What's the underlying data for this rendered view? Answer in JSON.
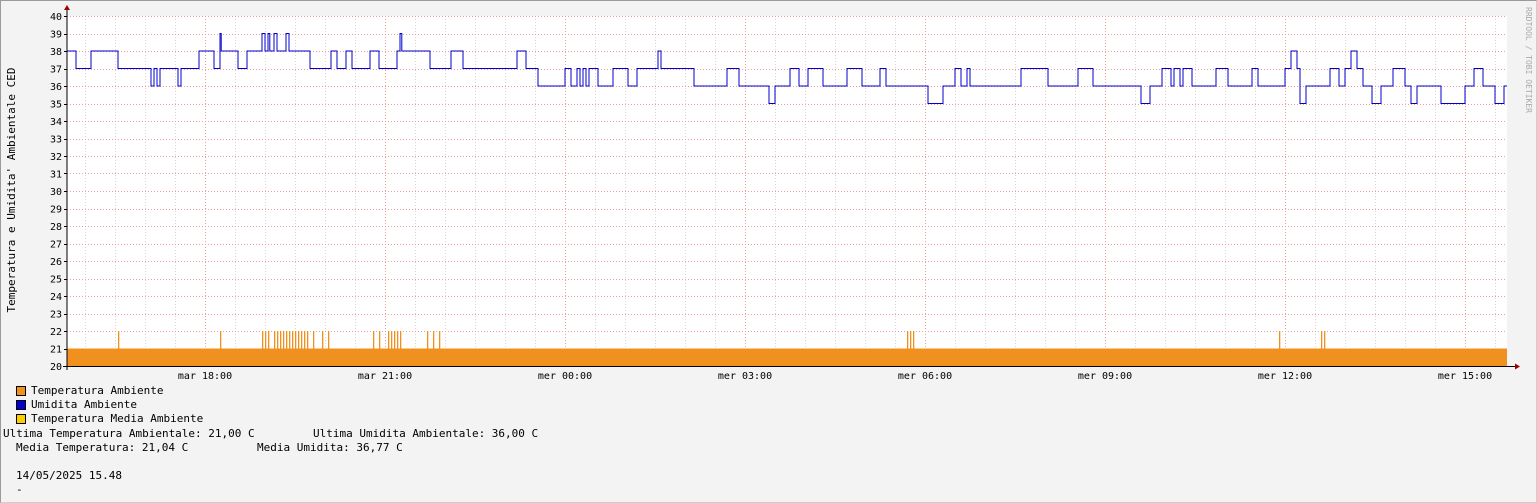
{
  "chart_data": {
    "type": "area",
    "ylabel": "Temperatura e Umidita' Ambientale CED",
    "watermark": "RRDTOOL / TOBI OETIKER",
    "ylim": [
      20,
      40
    ],
    "yticks": [
      "20",
      "21",
      "22",
      "23",
      "24",
      "25",
      "26",
      "27",
      "28",
      "29",
      "30",
      "31",
      "32",
      "33",
      "34",
      "35",
      "36",
      "37",
      "38",
      "39",
      "40"
    ],
    "xlim_hours": [
      0,
      24
    ],
    "xticks": [
      {
        "label": "mar 18:00",
        "hour": 2.3
      },
      {
        "label": "mar 21:00",
        "hour": 5.3
      },
      {
        "label": "mer 00:00",
        "hour": 8.3
      },
      {
        "label": "mer 03:00",
        "hour": 11.3
      },
      {
        "label": "mer 06:00",
        "hour": 14.3
      },
      {
        "label": "mer 09:00",
        "hour": 17.3
      },
      {
        "label": "mer 12:00",
        "hour": 20.3
      },
      {
        "label": "mer 15:00",
        "hour": 23.3
      }
    ],
    "series": [
      {
        "name": "Temperatura Ambiente",
        "color": "#f0901e",
        "baseline": 21,
        "spikes_to_22": [
          0.85,
          2.55,
          3.25,
          3.3,
          3.35,
          3.45,
          3.5,
          3.55,
          3.6,
          3.65,
          3.7,
          3.75,
          3.8,
          3.85,
          3.9,
          3.95,
          4.0,
          4.1,
          4.25,
          4.35,
          5.1,
          5.2,
          5.35,
          5.4,
          5.45,
          5.5,
          5.55,
          6.0,
          6.1,
          6.2,
          14.0,
          14.05,
          14.1,
          20.2,
          20.9,
          20.95
        ]
      },
      {
        "name": "Umidita Ambiente",
        "color": "#0000cc",
        "points": [
          [
            0.0,
            38
          ],
          [
            0.15,
            37
          ],
          [
            0.4,
            38
          ],
          [
            0.85,
            37
          ],
          [
            1.4,
            36
          ],
          [
            1.45,
            37
          ],
          [
            1.5,
            36
          ],
          [
            1.55,
            37
          ],
          [
            1.85,
            36
          ],
          [
            1.9,
            37
          ],
          [
            2.2,
            38
          ],
          [
            2.45,
            37
          ],
          [
            2.55,
            39
          ],
          [
            2.57,
            38
          ],
          [
            2.85,
            37
          ],
          [
            3.0,
            38
          ],
          [
            3.2,
            38
          ],
          [
            3.25,
            39
          ],
          [
            3.3,
            38
          ],
          [
            3.35,
            39
          ],
          [
            3.38,
            38
          ],
          [
            3.45,
            39
          ],
          [
            3.5,
            38
          ],
          [
            3.65,
            39
          ],
          [
            3.7,
            38
          ],
          [
            3.75,
            38
          ],
          [
            3.95,
            38
          ],
          [
            4.05,
            37
          ],
          [
            4.4,
            38
          ],
          [
            4.5,
            37
          ],
          [
            4.65,
            38
          ],
          [
            4.75,
            37
          ],
          [
            5.05,
            38
          ],
          [
            5.2,
            37
          ],
          [
            5.3,
            37
          ],
          [
            5.5,
            38
          ],
          [
            5.55,
            39
          ],
          [
            5.58,
            38
          ],
          [
            5.65,
            38
          ],
          [
            5.95,
            38
          ],
          [
            6.05,
            37
          ],
          [
            6.4,
            38
          ],
          [
            6.6,
            37
          ],
          [
            6.65,
            37
          ],
          [
            6.75,
            37
          ],
          [
            7.4,
            37
          ],
          [
            7.5,
            38
          ],
          [
            7.65,
            37
          ],
          [
            7.85,
            36
          ],
          [
            8.2,
            36
          ],
          [
            8.3,
            37
          ],
          [
            8.4,
            36
          ],
          [
            8.5,
            37
          ],
          [
            8.55,
            36
          ],
          [
            8.6,
            37
          ],
          [
            8.65,
            36
          ],
          [
            8.7,
            37
          ],
          [
            8.85,
            36
          ],
          [
            9.05,
            36
          ],
          [
            9.1,
            37
          ],
          [
            9.35,
            36
          ],
          [
            9.5,
            37
          ],
          [
            9.75,
            37
          ],
          [
            9.85,
            38
          ],
          [
            9.9,
            37
          ],
          [
            10.35,
            37
          ],
          [
            10.45,
            36
          ],
          [
            10.6,
            36
          ],
          [
            10.9,
            36
          ],
          [
            11.0,
            37
          ],
          [
            11.2,
            36
          ],
          [
            11.5,
            36
          ],
          [
            11.7,
            35
          ],
          [
            11.8,
            36
          ],
          [
            11.9,
            36
          ],
          [
            12.05,
            37
          ],
          [
            12.2,
            36
          ],
          [
            12.35,
            37
          ],
          [
            12.5,
            37
          ],
          [
            12.6,
            36
          ],
          [
            12.8,
            36
          ],
          [
            13.0,
            37
          ],
          [
            13.25,
            36
          ],
          [
            13.45,
            36
          ],
          [
            13.55,
            37
          ],
          [
            13.65,
            36
          ],
          [
            13.95,
            36
          ],
          [
            14.05,
            36
          ],
          [
            14.25,
            36
          ],
          [
            14.35,
            35
          ],
          [
            14.6,
            36
          ],
          [
            14.7,
            36
          ],
          [
            14.8,
            37
          ],
          [
            14.9,
            36
          ],
          [
            15.0,
            37
          ],
          [
            15.05,
            36
          ],
          [
            15.7,
            36
          ],
          [
            15.9,
            37
          ],
          [
            16.35,
            36
          ],
          [
            16.65,
            36
          ],
          [
            16.85,
            37
          ],
          [
            17.1,
            36
          ],
          [
            17.75,
            36
          ],
          [
            17.9,
            35
          ],
          [
            18.05,
            36
          ],
          [
            18.25,
            37
          ],
          [
            18.4,
            36
          ],
          [
            18.45,
            37
          ],
          [
            18.55,
            36
          ],
          [
            18.6,
            37
          ],
          [
            18.75,
            36
          ],
          [
            18.95,
            36
          ],
          [
            19.15,
            37
          ],
          [
            19.35,
            36
          ],
          [
            19.65,
            36
          ],
          [
            19.75,
            37
          ],
          [
            19.85,
            36
          ],
          [
            20.3,
            37
          ],
          [
            20.4,
            38
          ],
          [
            20.5,
            37
          ],
          [
            20.55,
            35
          ],
          [
            20.65,
            36
          ],
          [
            20.95,
            36
          ],
          [
            21.05,
            37
          ],
          [
            21.2,
            36
          ],
          [
            21.3,
            37
          ],
          [
            21.4,
            38
          ],
          [
            21.5,
            37
          ],
          [
            21.6,
            36
          ],
          [
            21.75,
            35
          ],
          [
            21.9,
            36
          ],
          [
            22.0,
            36
          ],
          [
            22.1,
            37
          ],
          [
            22.3,
            36
          ],
          [
            22.4,
            35
          ],
          [
            22.5,
            36
          ],
          [
            22.8,
            36
          ],
          [
            22.9,
            35
          ],
          [
            23.1,
            35
          ],
          [
            23.3,
            36
          ],
          [
            23.45,
            37
          ],
          [
            23.6,
            36
          ],
          [
            23.8,
            35
          ],
          [
            23.95,
            36
          ],
          [
            24.0,
            36
          ]
        ]
      },
      {
        "name": "Temperatura Media Ambiente",
        "color": "#ffcc00"
      }
    ]
  },
  "stats": {
    "ultima_temp": "Ultima Temperatura Ambientale: 21,00 C",
    "ultima_umid": "Ultima Umidita Ambientale: 36,00 C",
    "media_temp": "Media Temperatura: 21,04 C",
    "media_umid": "Media Umidita: 36,77 C",
    "timestamp": "14/05/2025 15.48",
    "footer": "-"
  }
}
